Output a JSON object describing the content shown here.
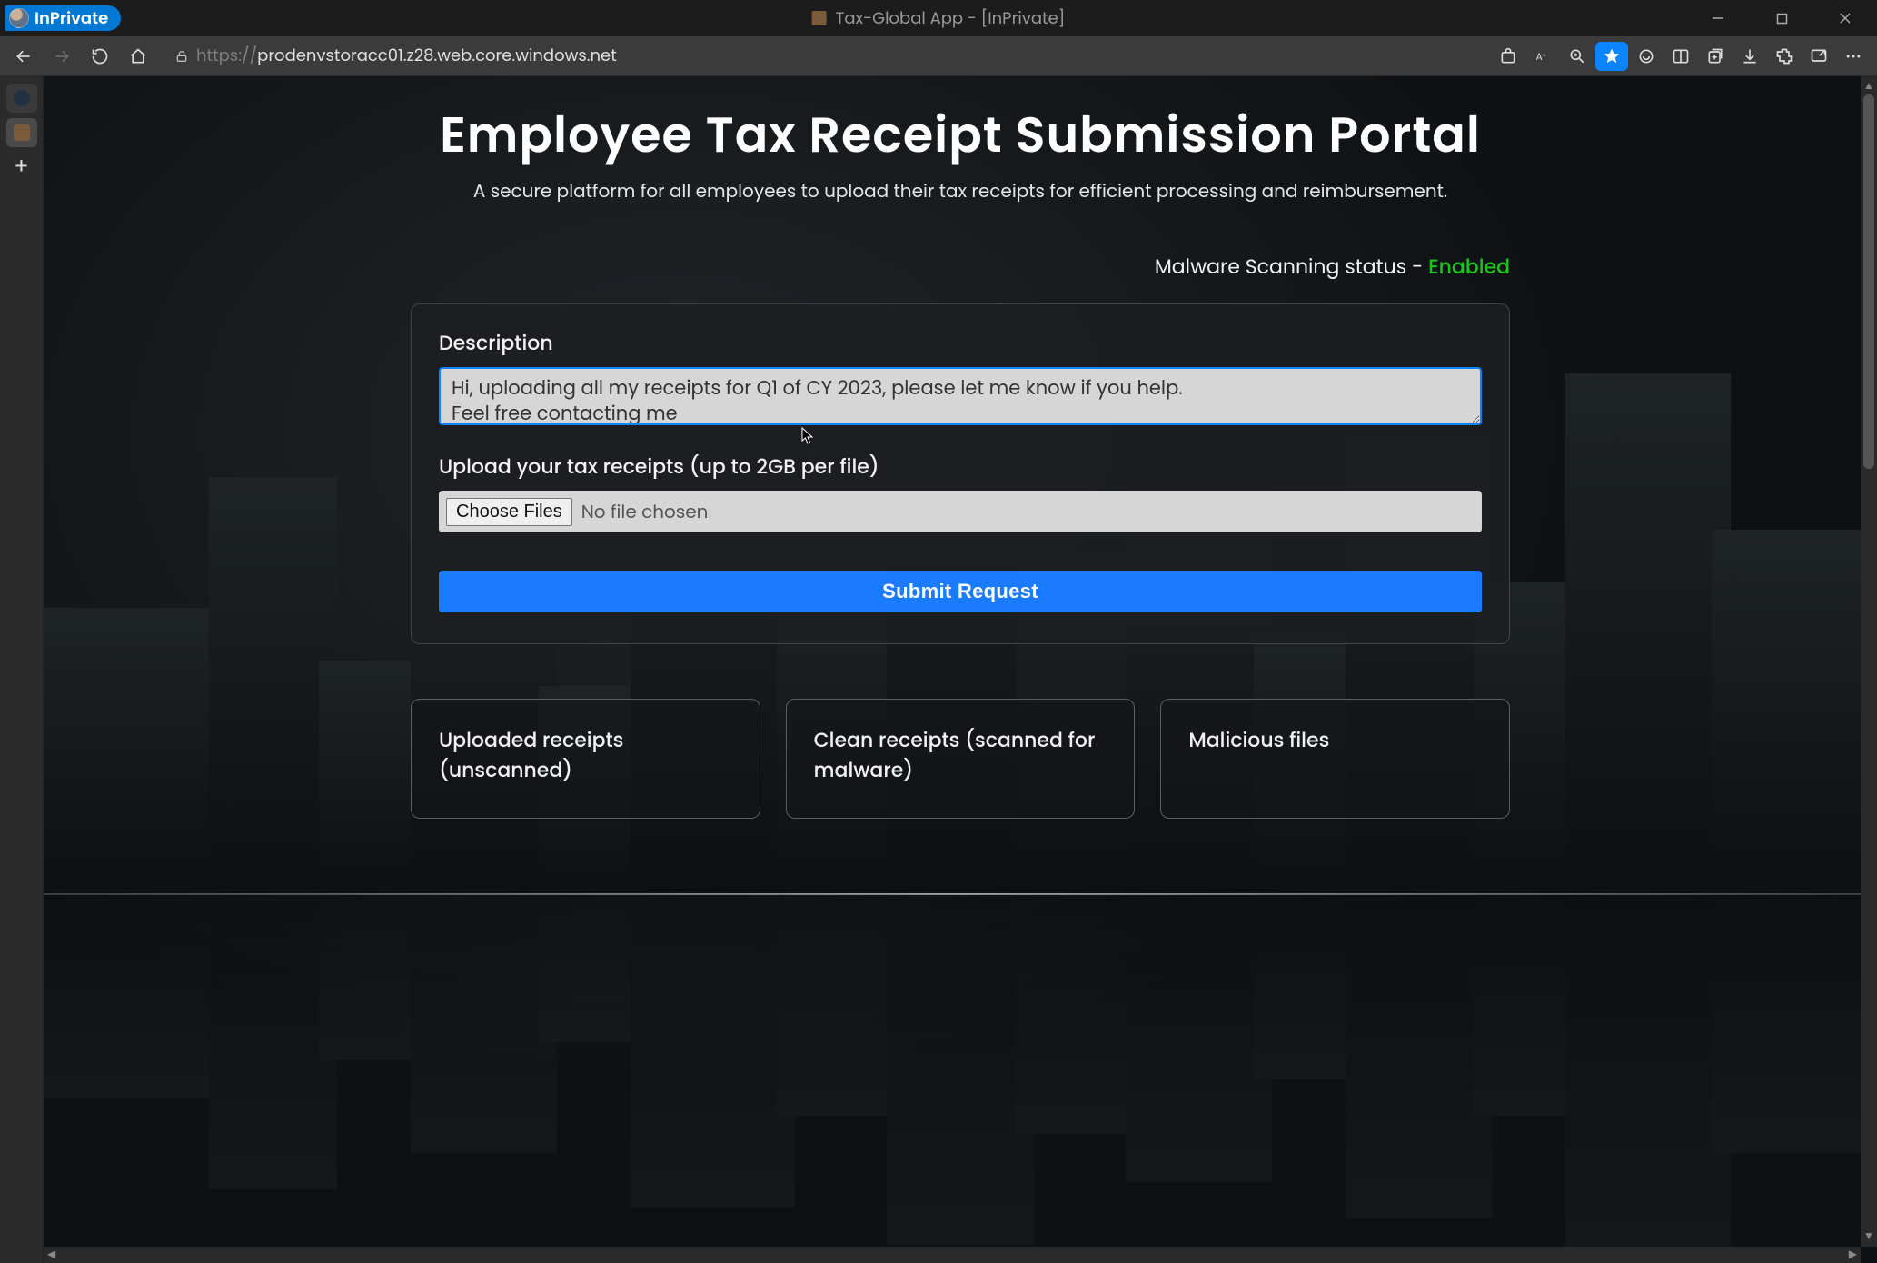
{
  "window": {
    "inprivate_label": "InPrivate",
    "title": "Tax-Global App - [InPrivate]"
  },
  "toolbar": {
    "url_protocol": "https://",
    "url_host": "prodenvstoracc01.z28.web.core.windows.net"
  },
  "page": {
    "title": "Employee Tax Receipt Submission Portal",
    "subtitle": "A secure platform for all employees to upload their tax receipts for efficient processing and reimbursement."
  },
  "status": {
    "label": "Malware Scanning status - ",
    "value": "Enabled"
  },
  "form": {
    "description_label": "Description",
    "description_value": "Hi, uploading all my receipts for Q1 of CY 2023, please let me know if you help.\nFeel free contacting me",
    "upload_label": "Upload your tax receipts (up to 2GB per file)",
    "choose_files_label": "Choose Files",
    "no_file_text": "No file chosen",
    "submit_label": "Submit Request"
  },
  "columns": {
    "uploaded": "Uploaded receipts (unscanned)",
    "clean": "Clean receipts (scanned for malware)",
    "malicious": "Malicious files"
  }
}
